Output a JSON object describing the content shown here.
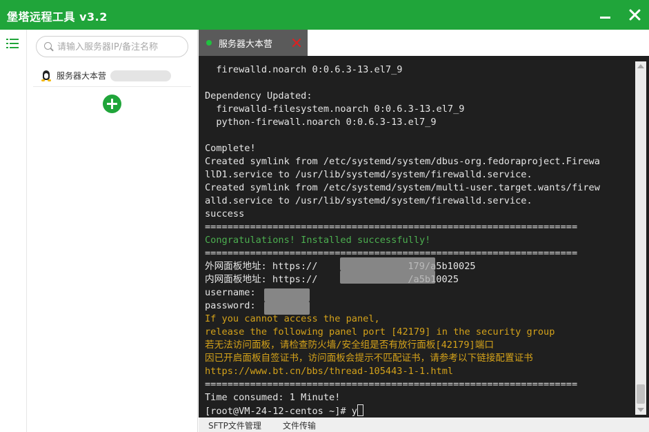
{
  "app": {
    "title": "堡塔远程工具  v3.2",
    "accent_color": "#20a53a"
  },
  "window_controls": [
    "minimize-icon",
    "close-icon"
  ],
  "sidebar": {
    "menu_icon": "list-icon",
    "search": {
      "placeholder": "请输入服务器IP/备注名称",
      "value": ""
    },
    "servers": [
      {
        "os_icon": "linux-tux-icon",
        "name": "服务器大本营"
      }
    ],
    "add_icon": "plus-circle-icon"
  },
  "tabs": [
    {
      "label": "服务器大本营",
      "status_color": "#20c23f",
      "close_icon": "close-icon"
    }
  ],
  "terminal": {
    "lines": [
      {
        "text": "  firewalld.noarch 0:0.6.3-13.el7_9",
        "color": "default"
      },
      {
        "text": "",
        "color": "default"
      },
      {
        "text": "Dependency Updated:",
        "color": "default"
      },
      {
        "text": "  firewalld-filesystem.noarch 0:0.6.3-13.el7_9",
        "color": "default"
      },
      {
        "text": "  python-firewall.noarch 0:0.6.3-13.el7_9",
        "color": "default"
      },
      {
        "text": "",
        "color": "default"
      },
      {
        "text": "Complete!",
        "color": "default"
      },
      {
        "text": "Created symlink from /etc/systemd/system/dbus-org.fedoraproject.Firewa",
        "color": "default"
      },
      {
        "text": "llD1.service to /usr/lib/systemd/system/firewalld.service.",
        "color": "default"
      },
      {
        "text": "Created symlink from /etc/systemd/system/multi-user.target.wants/firew",
        "color": "default"
      },
      {
        "text": "alld.service to /usr/lib/systemd/system/firewalld.service.",
        "color": "default"
      },
      {
        "text": "success",
        "color": "default"
      },
      {
        "text": "==================================================================",
        "color": "default"
      },
      {
        "text": "Congratulations! Installed successfully!",
        "color": "green"
      },
      {
        "text": "==================================================================",
        "color": "default"
      },
      {
        "text": "外网面板地址: https://                179/a5b10025",
        "color": "default"
      },
      {
        "text": "内网面板地址: https://                /a5b10025",
        "color": "default"
      },
      {
        "text": "username:",
        "color": "default"
      },
      {
        "text": "password:",
        "color": "default"
      },
      {
        "text": "If you cannot access the panel,",
        "color": "yellow"
      },
      {
        "text": "release the following panel port [42179] in the security group",
        "color": "yellow"
      },
      {
        "text": "若无法访问面板，请检查防火墙/安全组是否有放行面板[42179]端口",
        "color": "yellow"
      },
      {
        "text": "因已开启面板自签证书，访问面板会提示不匹配证书，请参考以下链接配置证书",
        "color": "yellow"
      },
      {
        "text": "https://www.bt.cn/bbs/thread-105443-1-1.html",
        "color": "yellow"
      },
      {
        "text": "==================================================================",
        "color": "default"
      },
      {
        "text": "Time consumed: 1 Minute!",
        "color": "default"
      },
      {
        "text": "[root@VM-24-12-centos ~]# y",
        "color": "default"
      }
    ],
    "colors": {
      "default": "#e6e6e6",
      "green": "#4caf50",
      "yellow": "#d4a21a",
      "background": "#1f1f1f"
    }
  },
  "bottom_tabs": [
    "SFTP文件管理",
    "文件传输"
  ]
}
